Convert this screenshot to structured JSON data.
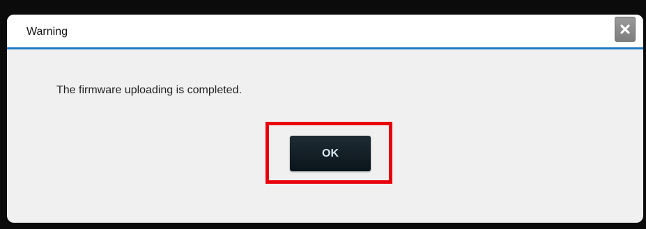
{
  "dialog": {
    "title": "Warning",
    "message": "The firmware uploading is completed.",
    "ok_label": "OK",
    "close_icon": "close-icon"
  },
  "colors": {
    "title_underline": "#1d7ac6",
    "button_bg": "#0a141b",
    "button_text": "#d8e8ee",
    "highlight": "#e8000b",
    "close_bg": "#8a8a8a"
  }
}
